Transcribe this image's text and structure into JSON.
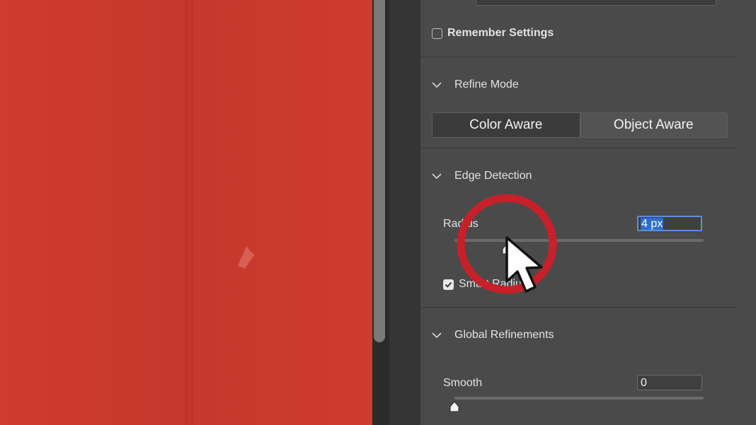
{
  "panel": {
    "remember_settings": {
      "label": "Remember Settings",
      "checked": false
    },
    "refine_mode": {
      "title": "Refine Mode",
      "options": [
        "Color Aware",
        "Object Aware"
      ],
      "selected": "Color Aware"
    },
    "edge_detection": {
      "title": "Edge Detection",
      "radius_label": "Radius",
      "radius_value": "4 px",
      "radius_slider_fraction": 0.21,
      "smart_radius_label": "Smart Radius",
      "smart_radius_checked": true
    },
    "global_refinements": {
      "title": "Global Refinements",
      "smooth_label": "Smooth",
      "smooth_value": "0",
      "smooth_slider_fraction": 0.0
    }
  },
  "colors": {
    "canvas": "#cf3b2e",
    "panel": "#4a4a4a",
    "highlight_ring": "#c8202a",
    "selection": "#2f6ed0"
  },
  "icons": [
    "chevron-down-icon",
    "checkmark-icon",
    "slider-thumb-icon",
    "cursor-arrow-icon",
    "highlight-ring"
  ]
}
